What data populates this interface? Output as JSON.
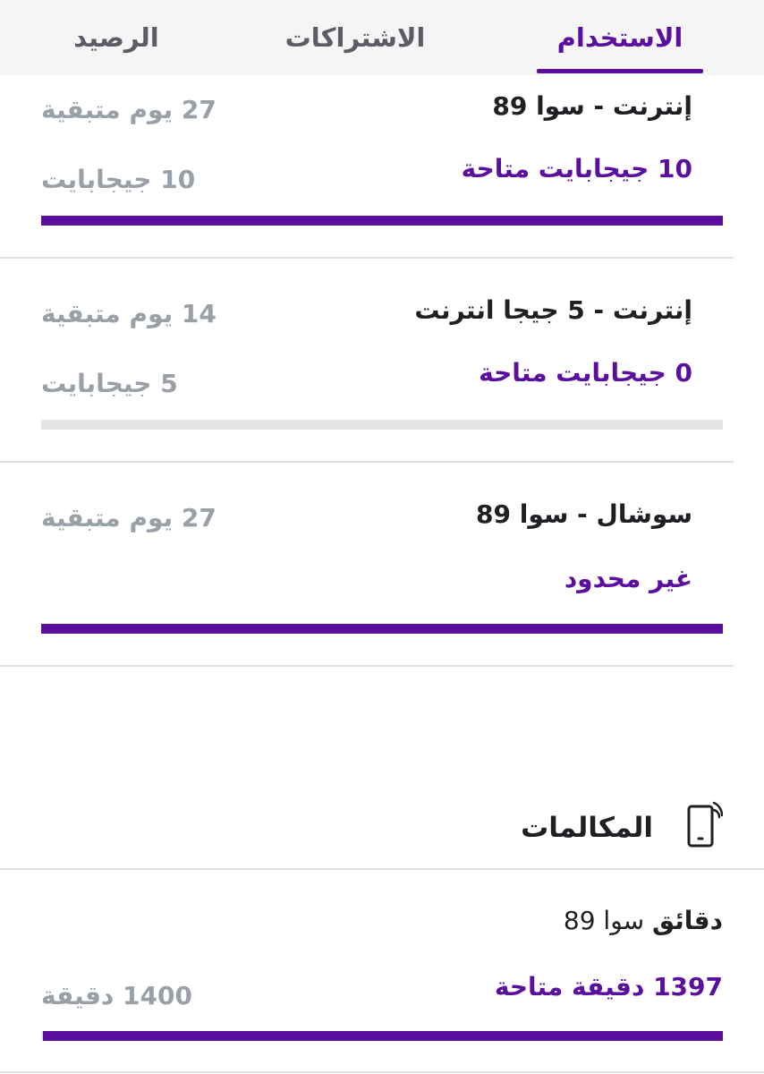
{
  "tabs": [
    {
      "label": "الاستخدام",
      "active": true
    },
    {
      "label": "الاشتراكات",
      "active": false
    },
    {
      "label": "الرصيد",
      "active": false
    }
  ],
  "data_packages": [
    {
      "title": "إنترنت - سوا 89",
      "days_left": "27 يوم متبقية",
      "available": "10 جيجابايت متاحة",
      "total": "10 جيجابايت",
      "remaining_fraction": 1.0
    },
    {
      "title": "إنترنت - 5 جيجا انترنت",
      "days_left": "14 يوم متبقية",
      "available": "0 جيجابايت متاحة",
      "total": "5 جيجابايت",
      "remaining_fraction": 0.0
    },
    {
      "title": "سوشال - سوا 89",
      "days_left": "27 يوم متبقية",
      "available": "غير محدود",
      "total": "",
      "remaining_fraction": 1.0
    }
  ],
  "calls": {
    "section_title": "المكالمات",
    "icon": "phone-icon",
    "item": {
      "title_bold": "دقائق",
      "title_rest": "سوا 89",
      "available": "1397 دقيقة متاحة",
      "total": "1400 دقيقة",
      "remaining_fraction": 0.998
    }
  },
  "colors": {
    "accent": "#5b0f9e",
    "muted": "#9aa0a8",
    "track": "#e5e5e5",
    "text": "#1f1f24"
  }
}
